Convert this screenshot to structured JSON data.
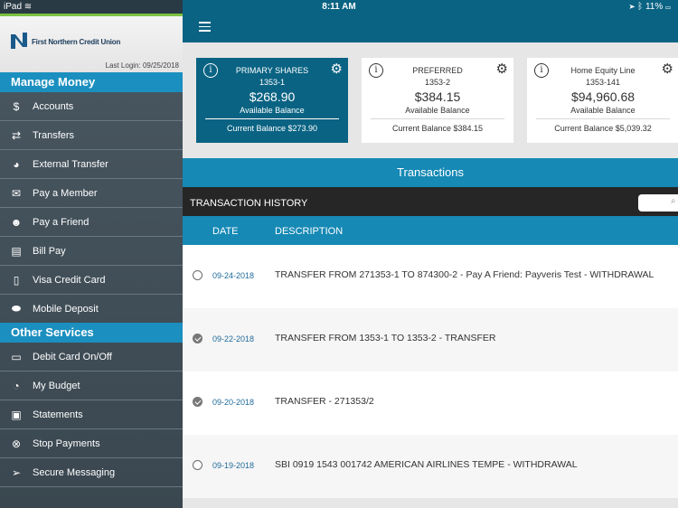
{
  "status_bar": {
    "device": "iPad",
    "time": "8:11 AM",
    "battery": "11%"
  },
  "logo": {
    "name": "First Northern Credit Union"
  },
  "last_login": {
    "label": "Last Login:",
    "date": "09/25/2018"
  },
  "sidebar": {
    "section_manage": "Manage Money",
    "manage_items": [
      {
        "label": "Accounts",
        "icon": "dollar-icon"
      },
      {
        "label": "Transfers",
        "icon": "transfer-arrows-icon"
      },
      {
        "label": "External Transfer",
        "icon": "external-transfer-icon"
      },
      {
        "label": "Pay a Member",
        "icon": "pay-member-icon"
      },
      {
        "label": "Pay a Friend",
        "icon": "pay-friend-icon"
      },
      {
        "label": "Bill Pay",
        "icon": "bill-pay-icon"
      },
      {
        "label": "Visa Credit Card",
        "icon": "credit-card-icon"
      },
      {
        "label": "Mobile Deposit",
        "icon": "mobile-deposit-icon"
      }
    ],
    "section_other": "Other Services",
    "other_items": [
      {
        "label": "Debit Card On/Off",
        "icon": "debit-card-icon"
      },
      {
        "label": "My Budget",
        "icon": "budget-pie-icon"
      },
      {
        "label": "Statements",
        "icon": "statements-icon"
      },
      {
        "label": "Stop Payments",
        "icon": "stop-icon"
      },
      {
        "label": "Secure Messaging",
        "icon": "send-icon"
      }
    ]
  },
  "accounts": [
    {
      "name": "PRIMARY SHARES",
      "number": "1353-1",
      "amount": "$268.90",
      "available_label": "Available Balance",
      "current": "Current Balance $273.90",
      "active": true
    },
    {
      "name": "PREFERRED",
      "number": "1353-2",
      "amount": "$384.15",
      "available_label": "Available Balance",
      "current": "Current Balance $384.15",
      "active": false
    },
    {
      "name": "Home Equity Line",
      "number": "1353-141",
      "amount": "$94,960.68",
      "available_label": "Available Balance",
      "current": "Current Balance $5,039.32",
      "active": false
    }
  ],
  "transactions": {
    "title": "Transactions",
    "history_label": "TRANSACTION HISTORY",
    "col_date": "DATE",
    "col_description": "DESCRIPTION",
    "rows": [
      {
        "date": "09-24-2018",
        "description": "TRANSFER FROM 271353-1 TO 874300-2 - Pay A Friend: Payveris Test - WITHDRAWAL",
        "checked": false
      },
      {
        "date": "09-22-2018",
        "description": "TRANSFER FROM 1353-1 TO 1353-2 - TRANSFER",
        "checked": true
      },
      {
        "date": "09-20-2018",
        "description": "TRANSFER - 271353/2",
        "checked": true
      },
      {
        "date": "09-19-2018",
        "description": "SBI 0919 1543 001742 AMERICAN AIRLINES TEMPE - WITHDRAWAL",
        "checked": false
      }
    ]
  },
  "colors": {
    "sidebar_section": "#1b8fbf",
    "topbar": "#0a6383",
    "accent_green": "#7cc242"
  }
}
